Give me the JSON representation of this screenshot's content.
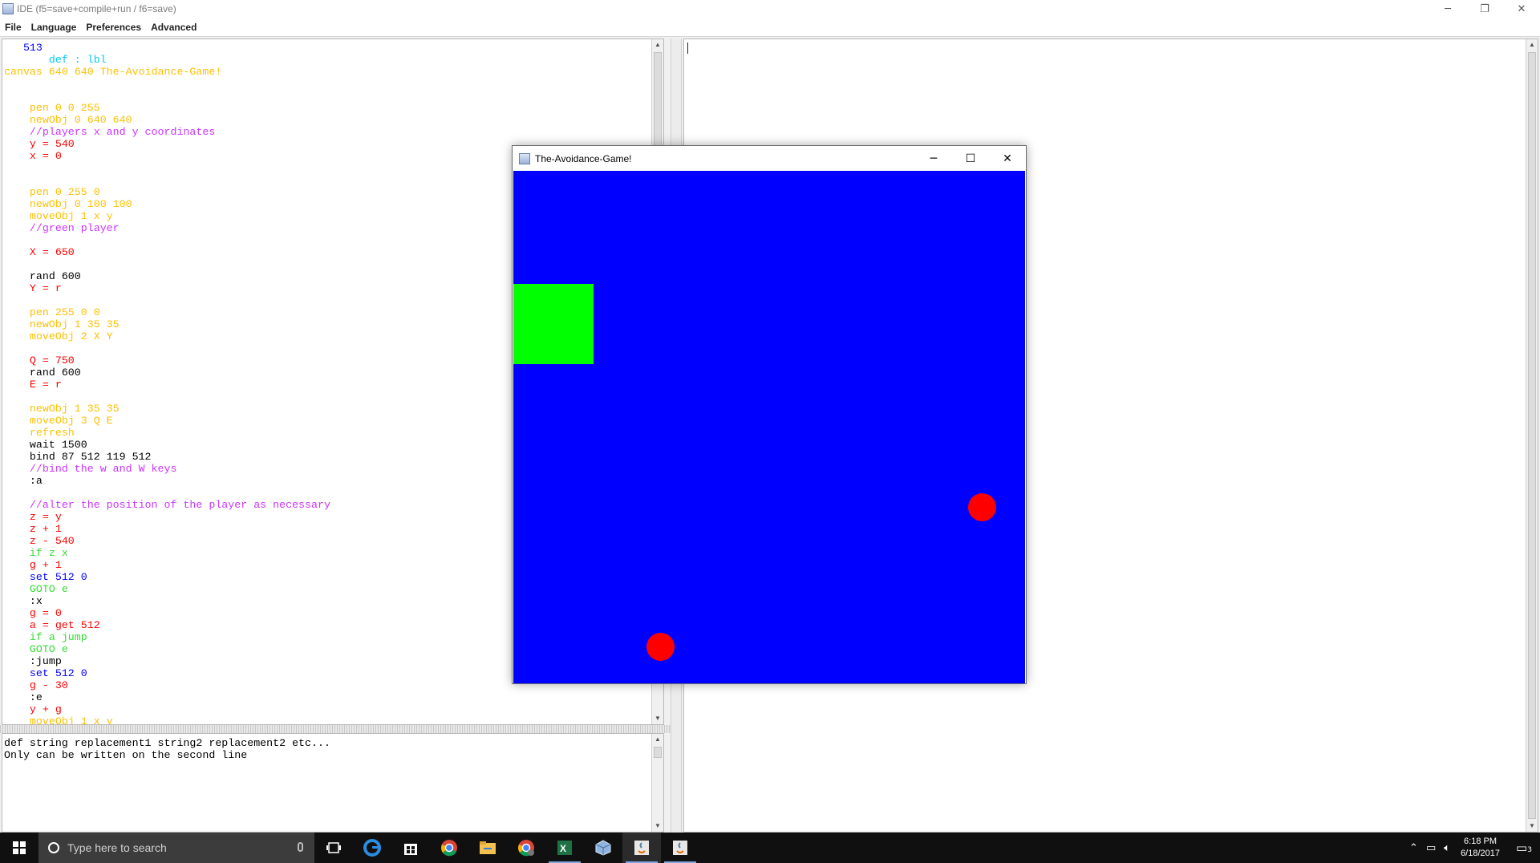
{
  "window": {
    "title": "IDE (f5=save+compile+run / f6=save)",
    "controls": {
      "minimize": "─",
      "maximize": "❐",
      "close": "✕"
    }
  },
  "menu": [
    "File",
    "Language",
    "Preferences",
    "Advanced"
  ],
  "code_lines": [
    {
      "text": "   513",
      "color": "#0000ff"
    },
    {
      "text": "       def : lbl",
      "color": "#00c8ff"
    },
    {
      "text": "canvas 640 640 The-Avoidance-Game!",
      "color": "#ffc000"
    },
    {
      "text": "",
      "color": "#000000"
    },
    {
      "text": "",
      "color": "#000000"
    },
    {
      "text": "    pen 0 0 255",
      "color": "#ffc000"
    },
    {
      "text": "    newObj 0 640 640",
      "color": "#ffc000"
    },
    {
      "text": "    //players x and y coordinates",
      "color": "#cc33ff"
    },
    {
      "text": "    y = 540",
      "color": "#ff0000"
    },
    {
      "text": "    x = 0",
      "color": "#ff0000"
    },
    {
      "text": "",
      "color": "#000000"
    },
    {
      "text": "",
      "color": "#000000"
    },
    {
      "text": "    pen 0 255 0",
      "color": "#ffc000"
    },
    {
      "text": "    newObj 0 100 100",
      "color": "#ffc000"
    },
    {
      "text": "    moveObj 1 x y",
      "color": "#ffc000"
    },
    {
      "text": "    //green player",
      "color": "#cc33ff"
    },
    {
      "text": "",
      "color": "#000000"
    },
    {
      "text": "    X = 650",
      "color": "#ff0000"
    },
    {
      "text": "",
      "color": "#000000"
    },
    {
      "text": "    rand 600",
      "color": "#000000"
    },
    {
      "text": "    Y = r",
      "color": "#ff0000"
    },
    {
      "text": "",
      "color": "#000000"
    },
    {
      "text": "    pen 255 0 0",
      "color": "#ffc000"
    },
    {
      "text": "    newObj 1 35 35",
      "color": "#ffc000"
    },
    {
      "text": "    moveObj 2 X Y",
      "color": "#ffc000"
    },
    {
      "text": "",
      "color": "#000000"
    },
    {
      "text": "    Q = 750",
      "color": "#ff0000"
    },
    {
      "text": "    rand 600",
      "color": "#000000"
    },
    {
      "text": "    E = r",
      "color": "#ff0000"
    },
    {
      "text": "",
      "color": "#000000"
    },
    {
      "text": "    newObj 1 35 35",
      "color": "#ffc000"
    },
    {
      "text": "    moveObj 3 Q E",
      "color": "#ffc000"
    },
    {
      "text": "    refresh",
      "color": "#ffc000"
    },
    {
      "text": "    wait 1500",
      "color": "#000000"
    },
    {
      "text": "    bind 87 512 119 512",
      "color": "#000000"
    },
    {
      "text": "    //bind the w and W keys",
      "color": "#cc33ff"
    },
    {
      "text": "    :a",
      "color": "#000000"
    },
    {
      "text": "",
      "color": "#000000"
    },
    {
      "text": "    //alter the position of the player as necessary",
      "color": "#cc33ff"
    },
    {
      "text": "    z = y",
      "color": "#ff0000"
    },
    {
      "text": "    z + 1",
      "color": "#ff0000"
    },
    {
      "text": "    z - 540",
      "color": "#ff0000"
    },
    {
      "text": "    if z x",
      "color": "#33dd33"
    },
    {
      "text": "    g + 1",
      "color": "#ff0000"
    },
    {
      "text": "    set 512 0",
      "color": "#0000ff"
    },
    {
      "text": "    GOTO e",
      "color": "#33dd33"
    },
    {
      "text": "    :x",
      "color": "#000000"
    },
    {
      "text": "    g = 0",
      "color": "#ff0000"
    },
    {
      "text": "    a = get 512",
      "color": "#ff0000"
    },
    {
      "text": "    if a jump",
      "color": "#33dd33"
    },
    {
      "text": "    GOTO e",
      "color": "#33dd33"
    },
    {
      "text": "    :jump",
      "color": "#000000"
    },
    {
      "text": "    set 512 0",
      "color": "#0000ff"
    },
    {
      "text": "    g - 30",
      "color": "#ff0000"
    },
    {
      "text": "    :e",
      "color": "#000000"
    },
    {
      "text": "    y + g",
      "color": "#ff0000"
    },
    {
      "text": "    moveObj 1 x y",
      "color": "#ffc000"
    }
  ],
  "console_lines": [
    "def string replacement1 string2 replacement2 etc...",
    "Only can be written on the second line"
  ],
  "game": {
    "title": "The-Avoidance-Game!",
    "controls": {
      "minimize": "─",
      "maximize": "☐",
      "close": "✕"
    },
    "background_color": "#0000ff",
    "player_color": "#00ff00",
    "enemy_color": "#ff0000"
  },
  "taskbar": {
    "search_placeholder": "Type here to search",
    "clock_time": "6:18 PM",
    "clock_date": "6/18/2017",
    "notification_count": "3",
    "apps": [
      "task-view-icon",
      "edge-icon",
      "store-icon",
      "chrome-icon",
      "file-explorer-icon",
      "chrome-alt-icon",
      "excel-icon",
      "virtualbox-icon",
      "java-icon",
      "java-active-icon"
    ]
  }
}
